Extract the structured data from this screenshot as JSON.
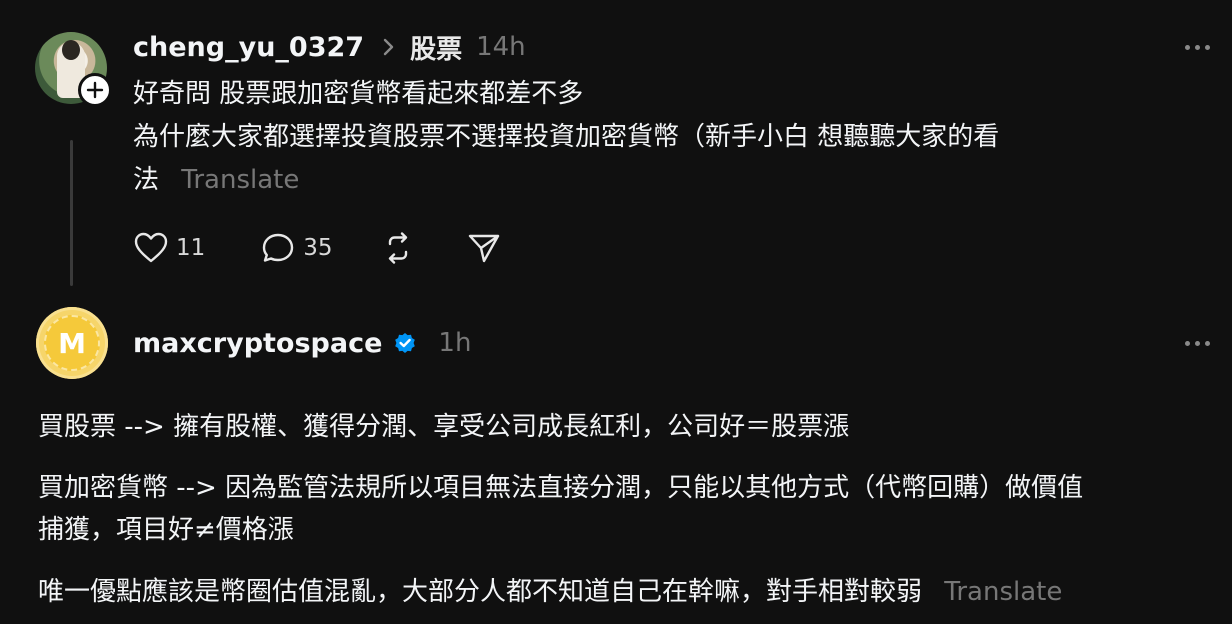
{
  "post1": {
    "username": "cheng_yu_0327",
    "topic": "股票",
    "time": "14h",
    "line1": "好奇問 股票跟加密貨幣看起來都差不多",
    "line2": "為什麼大家都選擇投資股票不選擇投資加密貨幣（新手小白 想聽聽大家的看",
    "line3": "法",
    "translate": "Translate",
    "likes": "11",
    "replies": "35",
    "icons": {
      "like": "heart-icon",
      "reply": "comment-icon",
      "repost": "repost-icon",
      "share": "send-icon",
      "follow": "plus-icon",
      "more": "more-icon"
    }
  },
  "post2": {
    "username": "maxcryptospace",
    "time": "1h",
    "avatar_letter": "M",
    "verified_color": "#0095f6",
    "para1": "買股票 --> 擁有股權、獲得分潤、享受公司成長紅利，公司好＝股票漲",
    "para2_line1": "買加密貨幣 --> 因為監管法規所以項目無法直接分潤，只能以其他方式（代幣回購）做價值",
    "para2_line2": "捕獲，項目好≠價格漲",
    "para3": "唯一優點應該是幣圈估值混亂，大部分人都不知道自己在幹嘛，對手相對較弱",
    "translate": "Translate",
    "icons": {
      "verified": "verified-badge-icon",
      "more": "more-icon"
    }
  }
}
